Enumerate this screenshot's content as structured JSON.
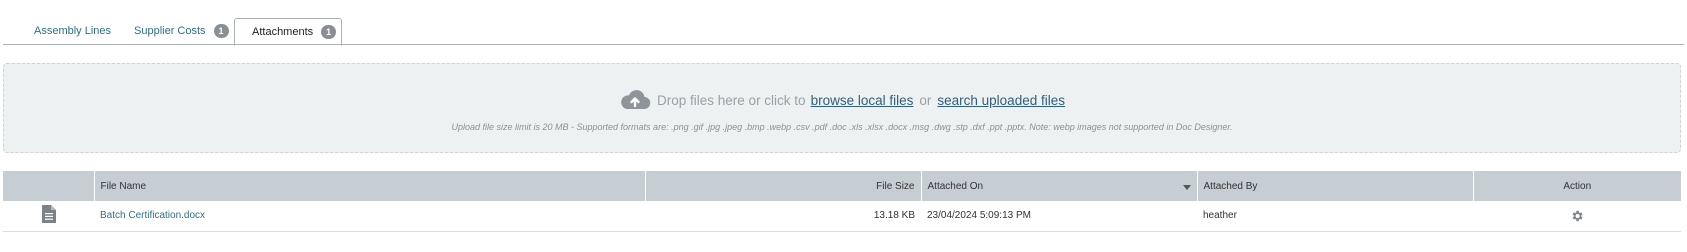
{
  "tabs": [
    {
      "label": "Assembly Lines",
      "badge": null,
      "active": false
    },
    {
      "label": "Supplier Costs",
      "badge": "1",
      "active": false
    },
    {
      "label": "Attachments",
      "badge": "1",
      "active": true
    }
  ],
  "dropzone": {
    "prompt": "Drop files here or click to",
    "browse_link": "browse local files",
    "or_text": "or",
    "search_link": "search uploaded files",
    "note": "Upload file size limit is 20 MB - Supported formats are: .png .gif .jpg .jpeg .bmp .webp .csv .pdf .doc .xls .xlsx .docx .msg .dwg .stp .dxf .ppt .pptx. Note: webp images not supported in Doc Designer.",
    "icon": "cloud-upload-icon"
  },
  "table": {
    "columns": {
      "icon": "",
      "file_name": "File Name",
      "file_size": "File Size",
      "attached_on": "Attached On",
      "attached_by": "Attached By",
      "action": "Action"
    },
    "rows": [
      {
        "icon": "document-icon",
        "file_name": "Batch Certification.docx",
        "file_size": "13.18 KB",
        "attached_on": "23/04/2024 5:09:13 PM",
        "attached_by": "heather",
        "action_icon": "gear-icon"
      }
    ]
  },
  "colors": {
    "accent": "#2f6f8c",
    "header_bg": "#c6cdd3",
    "dropzone_bg": "#edf1f2"
  }
}
